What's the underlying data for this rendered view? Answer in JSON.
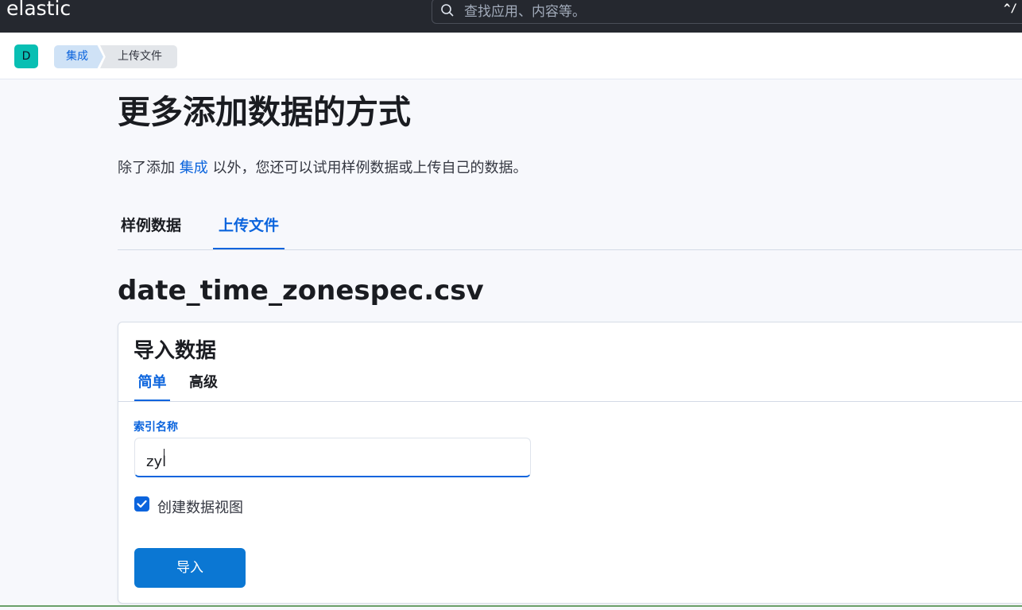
{
  "header": {
    "logo": "elastic",
    "search_placeholder": "查找应用、内容等。",
    "search_shortcut": "^/"
  },
  "subheader": {
    "avatar_initial": "D",
    "breadcrumbs": [
      "集成",
      "上传文件"
    ]
  },
  "page": {
    "title": "更多添加数据的方式",
    "description_prefix": "除了添加 ",
    "description_link": "集成",
    "description_suffix": " 以外，您还可以试用样例数据或上传自己的数据。",
    "tabs": [
      "样例数据",
      "上传文件"
    ],
    "active_tab": "上传文件",
    "filename": "date_time_zonespec.csv"
  },
  "import_panel": {
    "title": "导入数据",
    "tabs": [
      "简单",
      "高级"
    ],
    "active_tab": "简单",
    "index_name_label": "索引名称",
    "index_name_value": "zyl",
    "create_data_view_label": "创建数据视图",
    "create_data_view_checked": true,
    "import_button": "导入"
  },
  "colors": {
    "accent": "#0b64dd",
    "button": "#0b77d3",
    "header_bg": "#25282f",
    "avatar": "#08bfb3"
  }
}
